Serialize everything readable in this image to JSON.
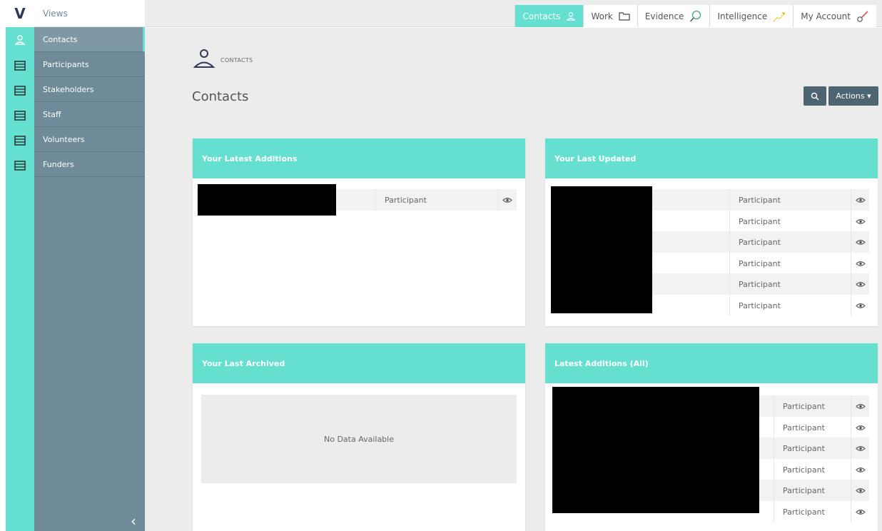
{
  "app": {
    "logo": "V",
    "views_label": "Views"
  },
  "sidebar": {
    "items": [
      {
        "label": "Contacts",
        "icon": "person-icon",
        "active": true
      },
      {
        "label": "Participants",
        "icon": "list-icon"
      },
      {
        "label": "Stakeholders",
        "icon": "list-icon"
      },
      {
        "label": "Staff",
        "icon": "list-icon"
      },
      {
        "label": "Volunteers",
        "icon": "list-icon"
      },
      {
        "label": "Funders",
        "icon": "list-icon"
      }
    ],
    "collapse_label": "‹"
  },
  "topnav": {
    "items": [
      {
        "label": "Contacts",
        "icon": "person-icon",
        "active": true
      },
      {
        "label": "Work",
        "icon": "folder-icon"
      },
      {
        "label": "Evidence",
        "icon": "magnifier-icon"
      },
      {
        "label": "Intelligence",
        "icon": "trend-icon"
      },
      {
        "label": "My Account",
        "icon": "key-icon"
      }
    ]
  },
  "breadcrumb": {
    "label": "CONTACTS"
  },
  "page": {
    "title": "Contacts",
    "actions_label": "Actions ▾"
  },
  "cards": {
    "latest_additions": {
      "title": "Your Latest Additions",
      "rows": [
        {
          "type": "Participant"
        }
      ]
    },
    "last_updated": {
      "title": "Your Last Updated",
      "rows": [
        {
          "type": "Participant"
        },
        {
          "type": "Participant"
        },
        {
          "type": "Participant"
        },
        {
          "type": "Participant"
        },
        {
          "type": "Participant"
        },
        {
          "type": "Participant"
        }
      ]
    },
    "last_archived": {
      "title": "Your Last Archived",
      "empty_message": "No Data Available"
    },
    "latest_additions_all": {
      "title": "Latest Additions (All)",
      "rows": [
        {
          "type": "Participant"
        },
        {
          "type": "Participant"
        },
        {
          "type": "Participant"
        },
        {
          "type": "Participant"
        },
        {
          "type": "Participant"
        },
        {
          "type": "Participant"
        }
      ]
    }
  },
  "colors": {
    "accent": "#64dfd0",
    "sidebar": "#6f8a98",
    "button": "#4d6570"
  }
}
